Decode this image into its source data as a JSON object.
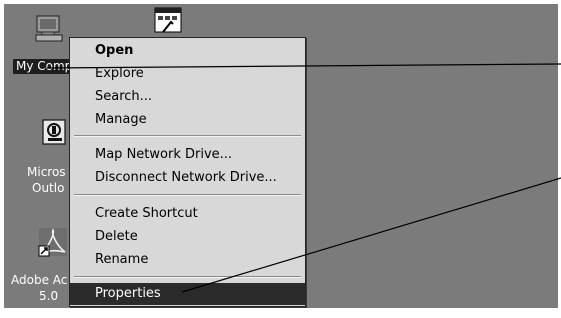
{
  "desktop": {
    "icons": [
      {
        "label_lines": [
          "My Computer"
        ],
        "visible_label": "My Comp",
        "icon": "computer-icon"
      },
      {
        "label_lines": [
          "Micros",
          "Outlo"
        ],
        "icon": "outlook-icon"
      },
      {
        "label_lines": [
          "Adobe Ac",
          "5.0"
        ],
        "icon": "adobe-acrobat-icon"
      },
      {
        "label_lines": [],
        "icon": "program-window-icon"
      }
    ]
  },
  "context_menu": {
    "items": [
      {
        "label": "Open",
        "bold": true
      },
      {
        "label": "Explore"
      },
      {
        "label": "Search..."
      },
      {
        "label": "Manage"
      },
      {
        "label": "Map Network Drive..."
      },
      {
        "label": "Disconnect Network Drive..."
      },
      {
        "label": "Create Shortcut"
      },
      {
        "label": "Delete"
      },
      {
        "label": "Rename"
      },
      {
        "label": "Properties",
        "highlighted": true
      }
    ]
  },
  "colors": {
    "desktop": "#7b7b7b",
    "menu": "#d8d8d8",
    "highlight": "#2b2b2b"
  }
}
